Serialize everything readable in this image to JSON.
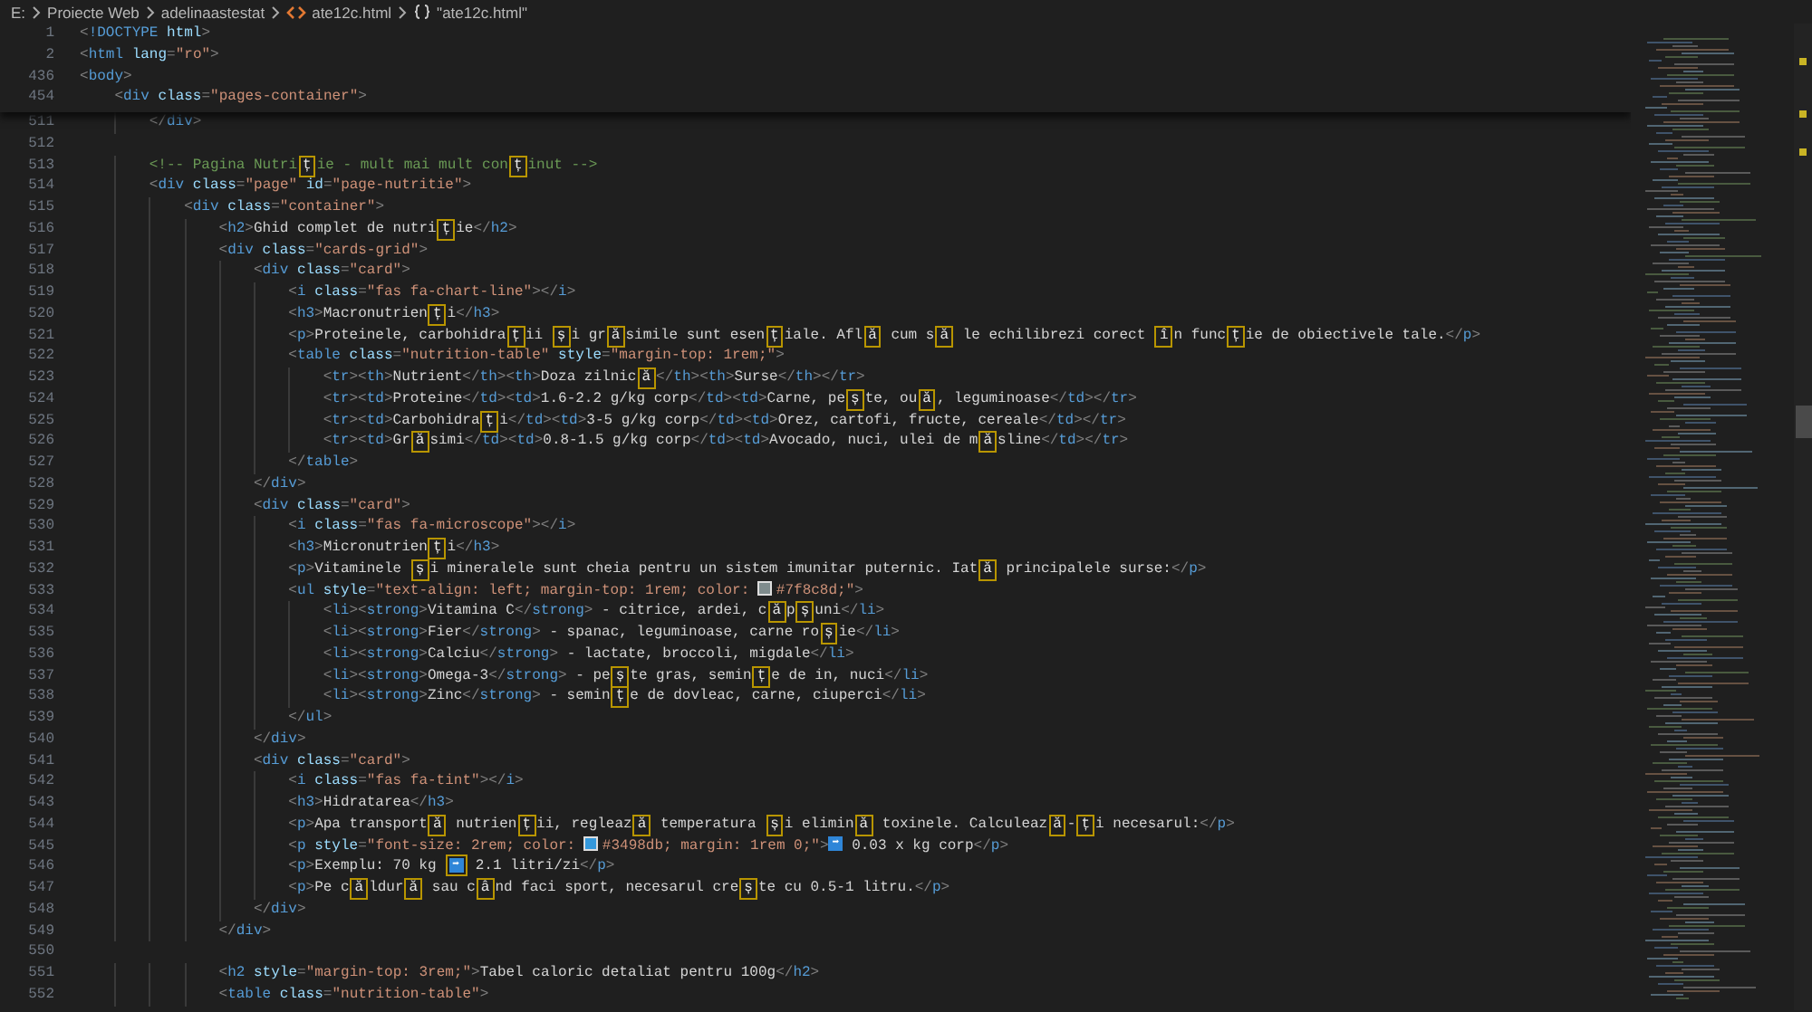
{
  "breadcrumb": [
    {
      "kind": "folder",
      "text": "E:"
    },
    {
      "kind": "folder",
      "text": "Proiecte Web"
    },
    {
      "kind": "folder",
      "text": "adelinaastestat"
    },
    {
      "kind": "file",
      "text": "ate12c.html"
    },
    {
      "kind": "symbol",
      "text": "\"ate12c.html\""
    }
  ],
  "sticky_lines": [
    {
      "number": "1",
      "segments": [
        {
          "kind": "code",
          "text": "<!DOCTYPE html>"
        }
      ]
    },
    {
      "number": "2",
      "segments": [
        {
          "kind": "code",
          "text": "<html lang=\"ro\">"
        }
      ]
    },
    {
      "number": "436",
      "segments": [
        {
          "kind": "code",
          "text": "<body>"
        }
      ]
    },
    {
      "number": "454",
      "segments": [
        {
          "kind": "code",
          "text": "    <div class=\"pages-container\">"
        }
      ]
    }
  ],
  "lines": [
    {
      "number": "511",
      "segments": [
        {
          "kind": "code",
          "text": "        </div>"
        }
      ]
    },
    {
      "number": "512"
    },
    {
      "number": "513",
      "segments": [
        {
          "kind": "code",
          "text": "        <!-- Pagina Nutri"
        },
        {
          "kind": "flagged",
          "text": "ț"
        },
        {
          "kind": "code",
          "text": "ie - mult mai mult con"
        },
        {
          "kind": "flagged",
          "text": "ț"
        },
        {
          "kind": "code",
          "text": "inut -->"
        }
      ]
    },
    {
      "number": "514",
      "segments": [
        {
          "kind": "code",
          "text": "        <div class=\"page\" id=\"page-nutritie\">"
        }
      ]
    },
    {
      "number": "515",
      "segments": [
        {
          "kind": "code",
          "text": "            <div class=\"container\">"
        }
      ]
    },
    {
      "number": "516",
      "segments": [
        {
          "kind": "code",
          "text": "                <h2>Ghid complet de nutri"
        },
        {
          "kind": "flagged",
          "text": "ț"
        },
        {
          "kind": "code",
          "text": "ie</h2>"
        }
      ]
    },
    {
      "number": "517",
      "segments": [
        {
          "kind": "code",
          "text": "                <div class=\"cards-grid\">"
        }
      ]
    },
    {
      "number": "518",
      "segments": [
        {
          "kind": "code",
          "text": "                    <div class=\"card\">"
        }
      ]
    },
    {
      "number": "519",
      "segments": [
        {
          "kind": "code",
          "text": "                        <i class=\"fas fa-chart-line\"></i>"
        }
      ]
    },
    {
      "number": "520",
      "segments": [
        {
          "kind": "code",
          "text": "                        <h3>Macronutrien"
        },
        {
          "kind": "flagged",
          "text": "ț"
        },
        {
          "kind": "code",
          "text": "i</h3>"
        }
      ]
    },
    {
      "number": "521",
      "segments": [
        {
          "kind": "code",
          "text": "                        <p>Proteinele, carbohidra"
        },
        {
          "kind": "flagged",
          "text": "ț"
        },
        {
          "kind": "code",
          "text": "ii "
        },
        {
          "kind": "flagged",
          "text": "ș"
        },
        {
          "kind": "code",
          "text": "i gr"
        },
        {
          "kind": "flagged",
          "text": "ă"
        },
        {
          "kind": "code",
          "text": "simile sunt esen"
        },
        {
          "kind": "flagged",
          "text": "ț"
        },
        {
          "kind": "code",
          "text": "iale. Afl"
        },
        {
          "kind": "flagged",
          "text": "ă"
        },
        {
          "kind": "code",
          "text": " cum s"
        },
        {
          "kind": "flagged",
          "text": "ă"
        },
        {
          "kind": "code",
          "text": " le echilibrezi corect "
        },
        {
          "kind": "flagged",
          "text": "î"
        },
        {
          "kind": "code",
          "text": "n func"
        },
        {
          "kind": "flagged",
          "text": "ț"
        },
        {
          "kind": "code",
          "text": "ie de obiectivele tale.</p>"
        }
      ]
    },
    {
      "number": "522",
      "segments": [
        {
          "kind": "code",
          "text": "                        <table class=\"nutrition-table\" style=\"margin-top: 1rem;\">"
        }
      ]
    },
    {
      "number": "523",
      "segments": [
        {
          "kind": "code",
          "text": "                            <tr><th>Nutrient</th><th>Doza zilnic"
        },
        {
          "kind": "flagged",
          "text": "ă"
        },
        {
          "kind": "code",
          "text": "</th><th>Surse</th></tr>"
        }
      ]
    },
    {
      "number": "524",
      "segments": [
        {
          "kind": "code",
          "text": "                            <tr><td>Proteine</td><td>1.6-2.2 g/kg corp</td><td>Carne, pe"
        },
        {
          "kind": "flagged",
          "text": "ș"
        },
        {
          "kind": "code",
          "text": "te, ou"
        },
        {
          "kind": "flagged",
          "text": "ă"
        },
        {
          "kind": "code",
          "text": ", leguminoase</td></tr>"
        }
      ]
    },
    {
      "number": "525",
      "segments": [
        {
          "kind": "code",
          "text": "                            <tr><td>Carbohidra"
        },
        {
          "kind": "flagged",
          "text": "ț"
        },
        {
          "kind": "code",
          "text": "i</td><td>3-5 g/kg corp</td><td>Orez, cartofi, fructe, cereale</td></tr>"
        }
      ]
    },
    {
      "number": "526",
      "segments": [
        {
          "kind": "code",
          "text": "                            <tr><td>Gr"
        },
        {
          "kind": "flagged",
          "text": "ă"
        },
        {
          "kind": "code",
          "text": "simi</td><td>0.8-1.5 g/kg corp</td><td>Avocado, nuci, ulei de m"
        },
        {
          "kind": "flagged",
          "text": "ă"
        },
        {
          "kind": "code",
          "text": "sline</td></tr>"
        }
      ]
    },
    {
      "number": "527",
      "segments": [
        {
          "kind": "code",
          "text": "                        </table>"
        }
      ]
    },
    {
      "number": "528",
      "segments": [
        {
          "kind": "code",
          "text": "                    </div>"
        }
      ]
    },
    {
      "number": "529",
      "segments": [
        {
          "kind": "code",
          "text": "                    <div class=\"card\">"
        }
      ]
    },
    {
      "number": "530",
      "segments": [
        {
          "kind": "code",
          "text": "                        <i class=\"fas fa-microscope\"></i>"
        }
      ]
    },
    {
      "number": "531",
      "segments": [
        {
          "kind": "code",
          "text": "                        <h3>Micronutrien"
        },
        {
          "kind": "flagged",
          "text": "ț"
        },
        {
          "kind": "code",
          "text": "i</h3>"
        }
      ]
    },
    {
      "number": "532",
      "segments": [
        {
          "kind": "code",
          "text": "                        <p>Vitaminele "
        },
        {
          "kind": "flagged",
          "text": "ș"
        },
        {
          "kind": "code",
          "text": "i mineralele sunt cheia pentru un sistem imunitar puternic. Iat"
        },
        {
          "kind": "flagged",
          "text": "ă"
        },
        {
          "kind": "code",
          "text": " principalele surse:</p>"
        }
      ]
    },
    {
      "number": "533",
      "segments": [
        {
          "kind": "code",
          "text": "                        <ul style=\"text-align: left; margin-top: 1rem; color: "
        },
        {
          "kind": "swatch",
          "color": "#7f8c8d"
        },
        {
          "kind": "code",
          "text": "#7f8c8d;\">"
        }
      ]
    },
    {
      "number": "534",
      "segments": [
        {
          "kind": "code",
          "text": "                            <li><strong>Vitamina C</strong> - citrice, ardei, c"
        },
        {
          "kind": "flagged",
          "text": "ă"
        },
        {
          "kind": "code",
          "text": "p"
        },
        {
          "kind": "flagged",
          "text": "ș"
        },
        {
          "kind": "code",
          "text": "uni</li>"
        }
      ]
    },
    {
      "number": "535",
      "segments": [
        {
          "kind": "code",
          "text": "                            <li><strong>Fier</strong> - spanac, leguminoase, carne ro"
        },
        {
          "kind": "flagged",
          "text": "ș"
        },
        {
          "kind": "code",
          "text": "ie</li>"
        }
      ]
    },
    {
      "number": "536",
      "segments": [
        {
          "kind": "code",
          "text": "                            <li><strong>Calciu</strong> - lactate, broccoli, migdale</li>"
        }
      ]
    },
    {
      "number": "537",
      "segments": [
        {
          "kind": "code",
          "text": "                            <li><strong>Omega-3</strong> - pe"
        },
        {
          "kind": "flagged",
          "text": "ș"
        },
        {
          "kind": "code",
          "text": "te gras, semin"
        },
        {
          "kind": "flagged",
          "text": "ț"
        },
        {
          "kind": "code",
          "text": "e de in, nuci</li>"
        }
      ]
    },
    {
      "number": "538",
      "segments": [
        {
          "kind": "code",
          "text": "                            <li><strong>Zinc</strong> - semin"
        },
        {
          "kind": "flagged",
          "text": "ț"
        },
        {
          "kind": "code",
          "text": "e de dovleac, carne, ciuperci</li>"
        }
      ]
    },
    {
      "number": "539",
      "segments": [
        {
          "kind": "code",
          "text": "                        </ul>"
        }
      ]
    },
    {
      "number": "540",
      "segments": [
        {
          "kind": "code",
          "text": "                    </div>"
        }
      ]
    },
    {
      "number": "541",
      "segments": [
        {
          "kind": "code",
          "text": "                    <div class=\"card\">"
        }
      ]
    },
    {
      "number": "542",
      "segments": [
        {
          "kind": "code",
          "text": "                        <i class=\"fas fa-tint\"></i>"
        }
      ]
    },
    {
      "number": "543",
      "segments": [
        {
          "kind": "code",
          "text": "                        <h3>Hidratarea</h3>"
        }
      ]
    },
    {
      "number": "544",
      "segments": [
        {
          "kind": "code",
          "text": "                        <p>Apa transport"
        },
        {
          "kind": "flagged",
          "text": "ă"
        },
        {
          "kind": "code",
          "text": " nutrien"
        },
        {
          "kind": "flagged",
          "text": "ț"
        },
        {
          "kind": "code",
          "text": "ii, regleaz"
        },
        {
          "kind": "flagged",
          "text": "ă"
        },
        {
          "kind": "code",
          "text": " temperatura "
        },
        {
          "kind": "flagged",
          "text": "ș"
        },
        {
          "kind": "code",
          "text": "i elimin"
        },
        {
          "kind": "flagged",
          "text": "ă"
        },
        {
          "kind": "code",
          "text": " toxinele. Calculeaz"
        },
        {
          "kind": "flagged",
          "text": "ă"
        },
        {
          "kind": "code",
          "text": "-"
        },
        {
          "kind": "flagged",
          "text": "ț"
        },
        {
          "kind": "code",
          "text": "i necesarul:</p>"
        }
      ]
    },
    {
      "number": "545",
      "segments": [
        {
          "kind": "code",
          "text": "                        <p style=\"font-size: 2rem; color: "
        },
        {
          "kind": "swatch",
          "color": "#3498db"
        },
        {
          "kind": "code",
          "text": "#3498db; margin: 1rem 0;\">"
        },
        {
          "kind": "emoji",
          "text": "➡"
        },
        {
          "kind": "code",
          "text": " 0.03 x kg corp</p>"
        }
      ]
    },
    {
      "number": "546",
      "segments": [
        {
          "kind": "code",
          "text": "                        <p>Exemplu: 70 kg "
        },
        {
          "kind": "flagged_emoji",
          "text": "➡"
        },
        {
          "kind": "code",
          "text": " 2.1 litri/zi</p>"
        }
      ]
    },
    {
      "number": "547",
      "segments": [
        {
          "kind": "code",
          "text": "                        <p>Pe c"
        },
        {
          "kind": "flagged",
          "text": "ă"
        },
        {
          "kind": "code",
          "text": "ldur"
        },
        {
          "kind": "flagged",
          "text": "ă"
        },
        {
          "kind": "code",
          "text": " sau c"
        },
        {
          "kind": "flagged",
          "text": "â"
        },
        {
          "kind": "code",
          "text": "nd faci sport, necesarul cre"
        },
        {
          "kind": "flagged",
          "text": "ș"
        },
        {
          "kind": "code",
          "text": "te cu 0.5-1 litru.</p>"
        }
      ]
    },
    {
      "number": "548",
      "segments": [
        {
          "kind": "code",
          "text": "                    </div>"
        }
      ]
    },
    {
      "number": "549",
      "segments": [
        {
          "kind": "code",
          "text": "                </div>"
        }
      ]
    },
    {
      "number": "550"
    },
    {
      "number": "551",
      "segments": [
        {
          "kind": "code",
          "text": "                <h2 style=\"margin-top: 3rem;\">Tabel caloric detaliat pentru 100g</h2>"
        }
      ]
    },
    {
      "number": "552",
      "segments": [
        {
          "kind": "code",
          "text": "                <table class=\"nutrition-table\">"
        }
      ]
    }
  ]
}
